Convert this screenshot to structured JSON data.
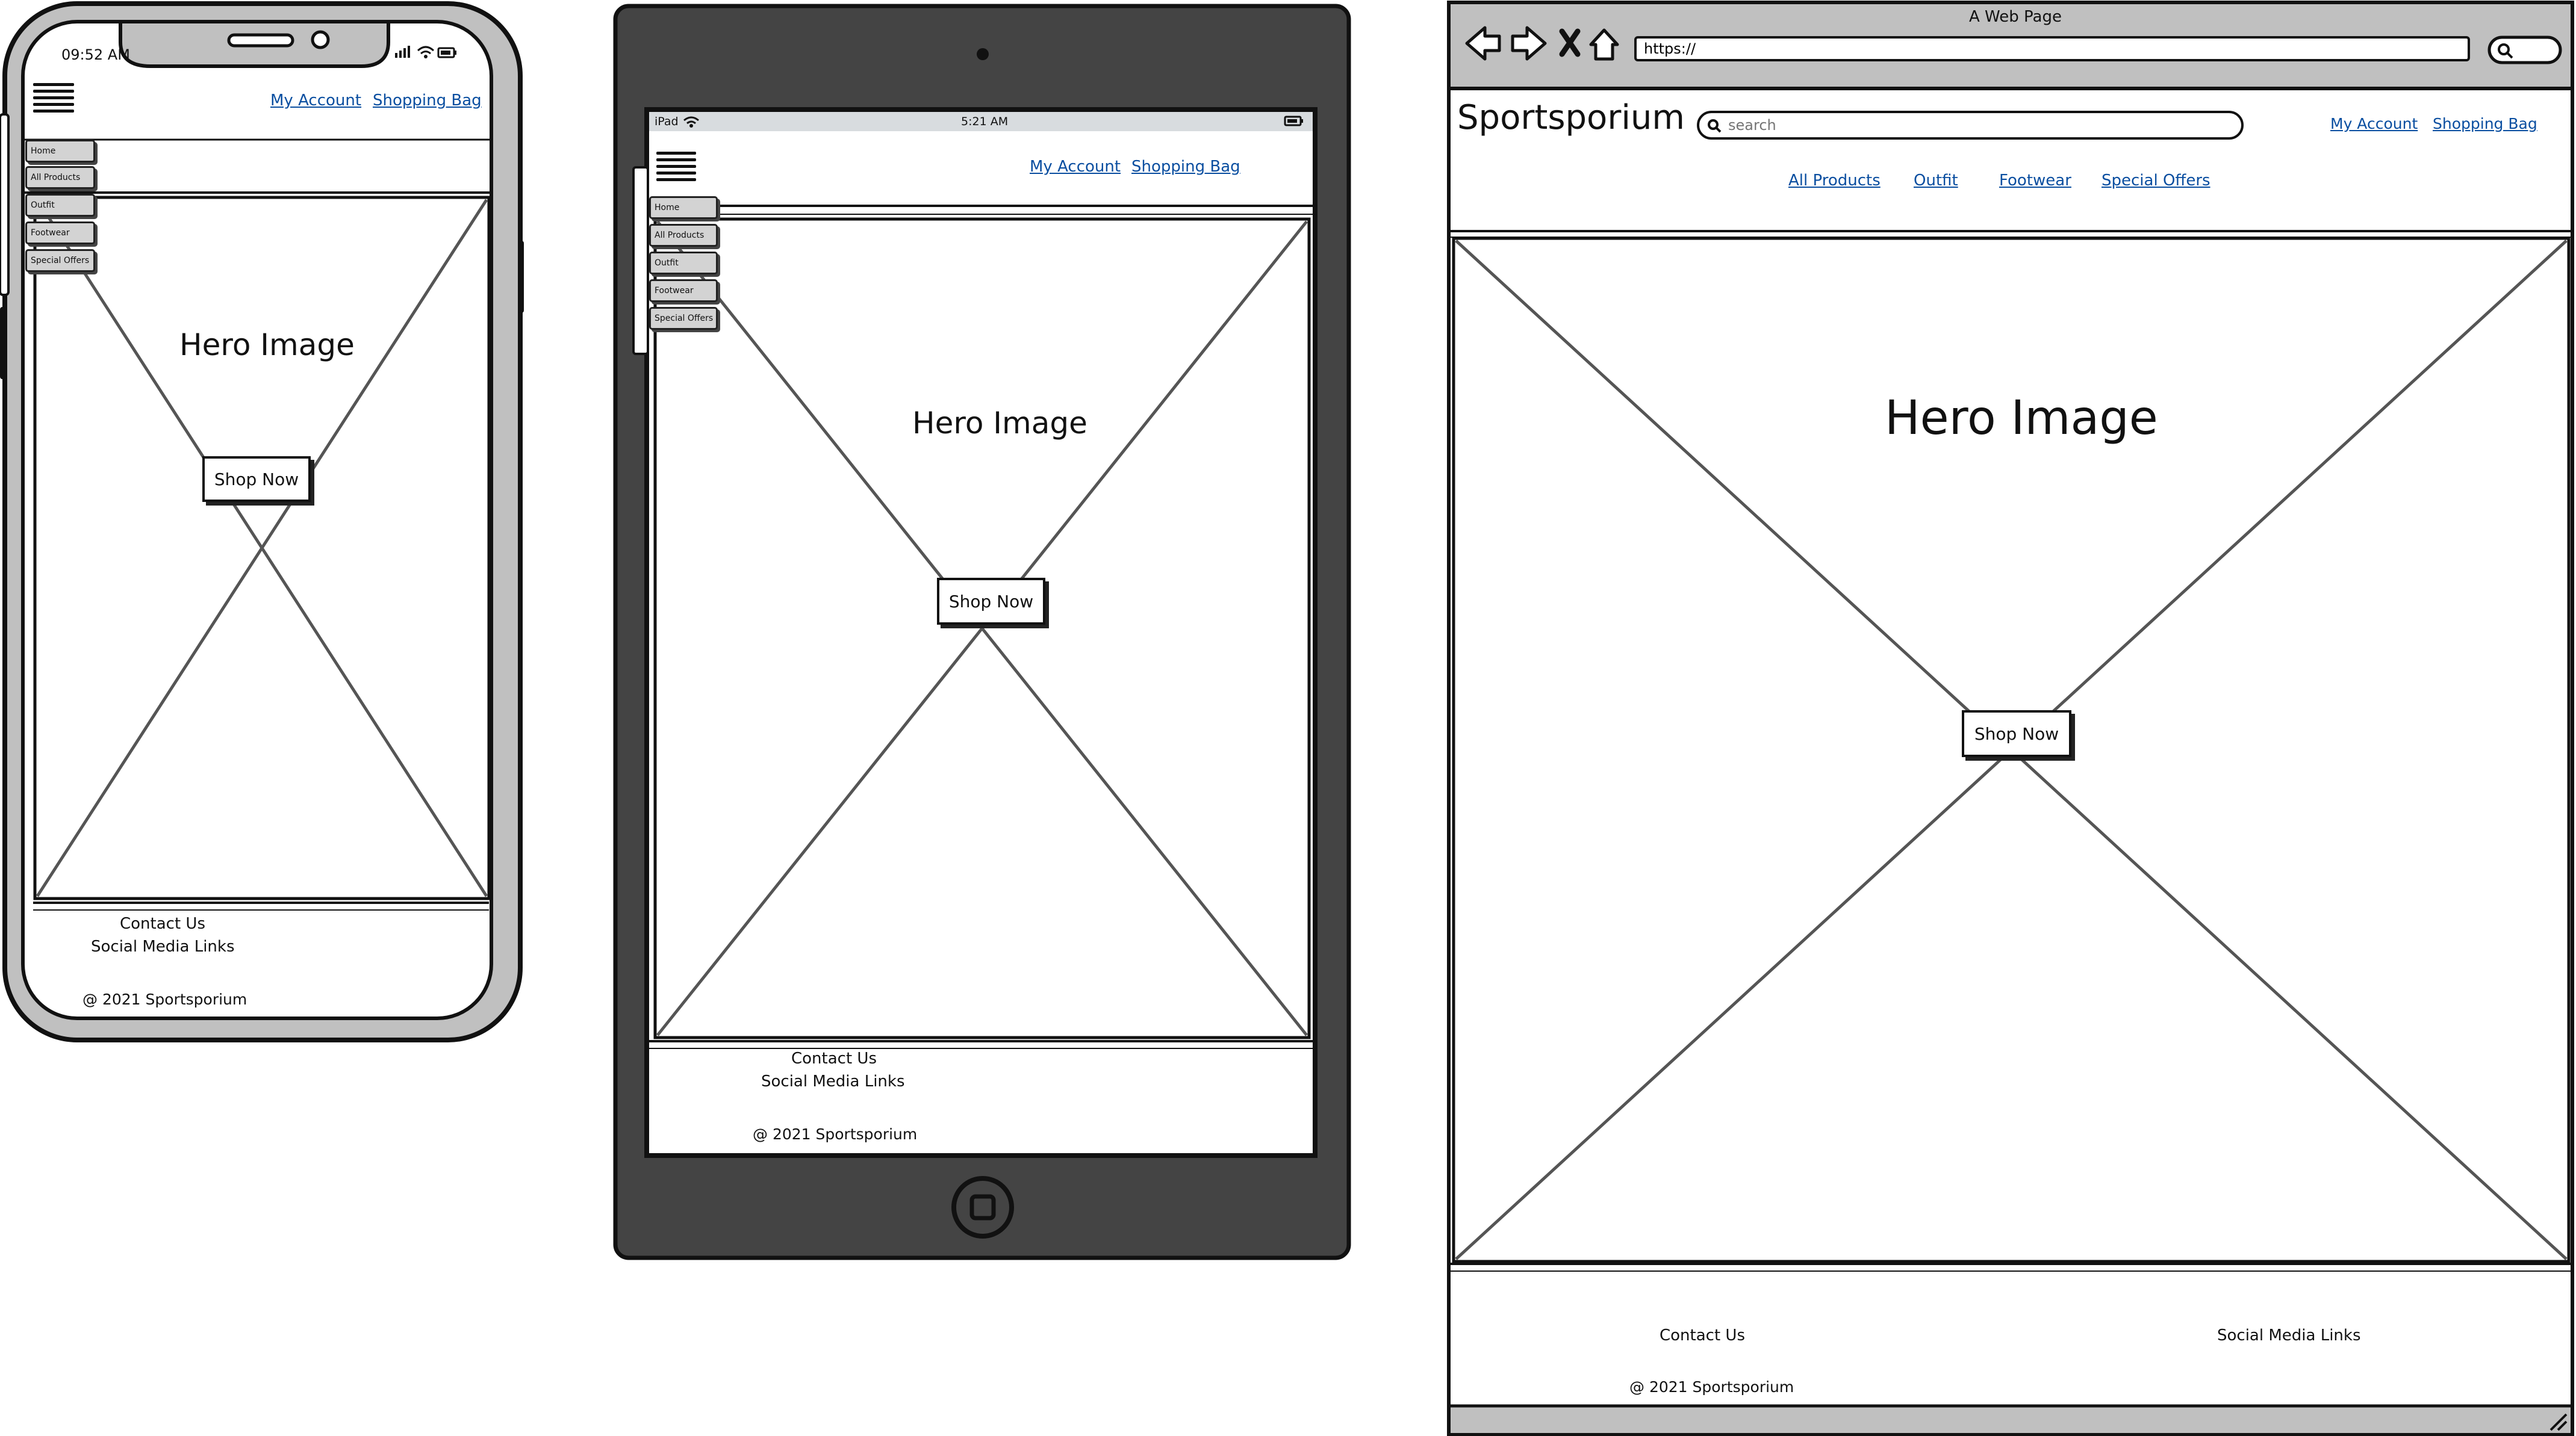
{
  "mobile": {
    "status_time": "09:52 AM",
    "nav": {
      "account": "My Account",
      "bag": "Shopping Bag"
    },
    "menu": [
      "Home",
      "All Products",
      "Outfit",
      "Footwear",
      "Special Offers"
    ],
    "hero_label": "Hero Image",
    "cta": "Shop Now",
    "footer": {
      "contact": "Contact Us",
      "social": "Social Media Links",
      "copyright": "@ 2021 Sportsporium"
    }
  },
  "tablet": {
    "status_device": "iPad",
    "status_time": "5:21 AM",
    "nav": {
      "account": "My Account",
      "bag": "Shopping Bag"
    },
    "menu": [
      "Home",
      "All Products",
      "Outfit",
      "Footwear",
      "Special Offers"
    ],
    "hero_label": "Hero Image",
    "cta": "Shop Now",
    "footer": {
      "contact": "Contact Us",
      "social": "Social Media Links",
      "copyright": "@ 2021 Sportsporium"
    }
  },
  "desktop": {
    "window_title": "A Web Page",
    "url": "https://",
    "brand": "Sportsporium",
    "search_placeholder": "search",
    "nav": {
      "account": "My Account",
      "bag": "Shopping Bag"
    },
    "categories": [
      "All Products",
      "Outfit",
      "Footwear",
      "Special Offers"
    ],
    "hero_label": "Hero Image",
    "cta": "Shop Now",
    "footer": {
      "contact": "Contact Us",
      "social": "Social Media Links",
      "copyright": "@ 2021 Sportsporium"
    }
  },
  "colors": {
    "link": "#0a4ea0",
    "tablet_frame": "#444444",
    "phone_frame": "#c0c0c0",
    "browser_chrome": "#c0c0c0"
  }
}
